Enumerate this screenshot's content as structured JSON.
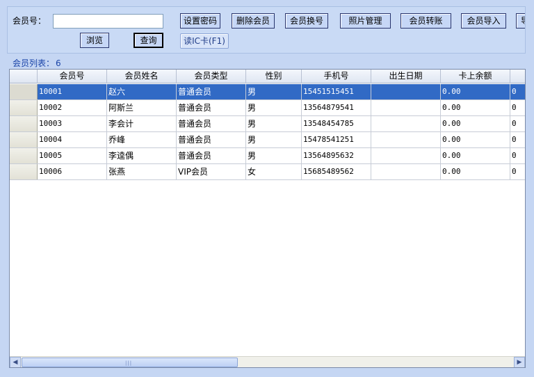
{
  "toolbar": {
    "member_no_label": "会员号：",
    "member_no_value": "",
    "buttons": {
      "set_password": "设置密码",
      "delete_member": "删除会员",
      "change_number": "会员换号",
      "photo_manage": "照片管理",
      "member_transfer": "会员转账",
      "member_import": "会员导入",
      "more": "导",
      "browse": "浏览",
      "query": "查询",
      "read_ic": "读IC卡(F1)"
    }
  },
  "list": {
    "caption": "会员列表：",
    "count": "6"
  },
  "table": {
    "columns": [
      "会员号",
      "会员姓名",
      "会员类型",
      "性别",
      "手机号",
      "出生日期",
      "卡上余额",
      ""
    ],
    "rows": [
      {
        "id": "10001",
        "name": "赵六",
        "type": "普通会员",
        "sex": "男",
        "phone": "15451515451",
        "birth": "",
        "balance": "0.00",
        "extra": "0"
      },
      {
        "id": "10002",
        "name": "阿斯兰",
        "type": "普通会员",
        "sex": "男",
        "phone": "13564879541",
        "birth": "",
        "balance": "0.00",
        "extra": "0"
      },
      {
        "id": "10003",
        "name": "李会计",
        "type": "普通会员",
        "sex": "男",
        "phone": "13548454785",
        "birth": "",
        "balance": "0.00",
        "extra": "0"
      },
      {
        "id": "10004",
        "name": "乔峰",
        "type": "普通会员",
        "sex": "男",
        "phone": "15478541251",
        "birth": "",
        "balance": "0.00",
        "extra": "0"
      },
      {
        "id": "10005",
        "name": "李逵偶",
        "type": "普通会员",
        "sex": "男",
        "phone": "13564895632",
        "birth": "",
        "balance": "0.00",
        "extra": "0"
      },
      {
        "id": "10006",
        "name": "张燕",
        "type": "VIP会员",
        "sex": "女",
        "phone": "15685489562",
        "birth": "",
        "balance": "0.00",
        "extra": "0"
      }
    ],
    "selected_row": 0
  },
  "scrollbar": {
    "left_icon": "arrow-left-icon",
    "right_icon": "arrow-right-icon"
  }
}
